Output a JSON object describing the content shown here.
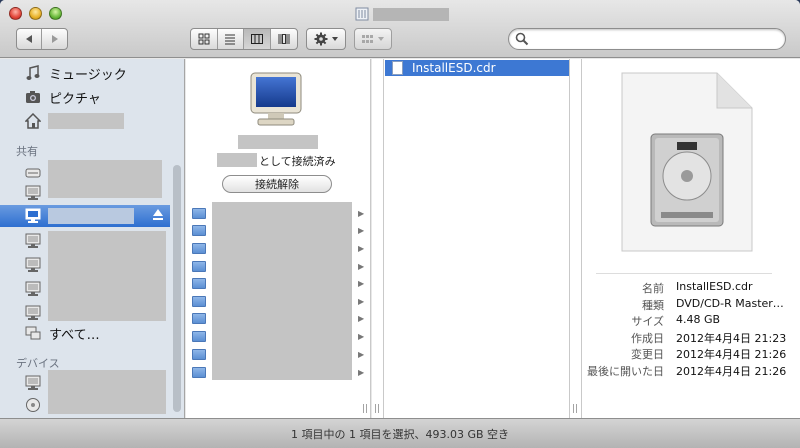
{
  "sidebar": {
    "items_top": [
      {
        "icon": "music-note-icon",
        "label": "ミュージック"
      },
      {
        "icon": "camera-icon",
        "label": "ピクチャ"
      }
    ],
    "section_shared": "共有",
    "show_all_label": "すべて…",
    "section_devices": "デバイス"
  },
  "server": {
    "connected_as_suffix": "として接続済み",
    "disconnect_label": "接続解除"
  },
  "file": {
    "name": "InstallESD.cdr"
  },
  "info": {
    "labels": [
      "名前",
      "種類",
      "サイズ",
      "作成日",
      "変更日",
      "最後に開いた日"
    ],
    "values": [
      "InstallESD.cdr",
      "DVD/CD-R Master…",
      "4.48 GB",
      "2012年4月4日 21:23",
      "2012年4月4日 21:26",
      "2012年4月4日 21:26"
    ]
  },
  "status": {
    "text": "1 項目中の 1 項目を選択、493.03 GB 空き"
  },
  "colors": {
    "selection": "#3d78d3",
    "sidebar_bg": "#dde4ec"
  }
}
